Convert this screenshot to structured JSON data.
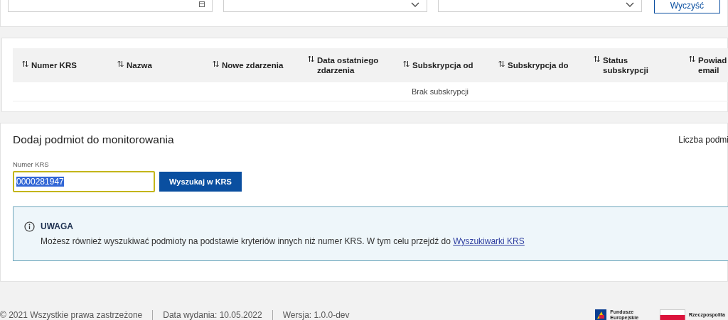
{
  "filters": {
    "fields": [
      {
        "kind": "date"
      },
      {
        "kind": "select"
      },
      {
        "kind": "select"
      }
    ],
    "clear_button": "Wyczyść"
  },
  "table": {
    "columns": [
      {
        "label": "Numer KRS"
      },
      {
        "label": "Nazwa"
      },
      {
        "label": "Nowe zdarzenia"
      },
      {
        "label": "Data ostatniego zdarzenia"
      },
      {
        "label": "Subskrypcja od"
      },
      {
        "label": "Subskrypcja do"
      },
      {
        "label": "Status subskrypcji"
      },
      {
        "label": "Powiad email"
      }
    ],
    "empty_text": "Brak subskrypcji"
  },
  "add_panel": {
    "title": "Dodaj podmiot do monitorowania",
    "count_label": "Liczba podmi",
    "field_label": "Numer KRS",
    "field_value": "0000281947",
    "value_selected": true,
    "search_button": "Wyszukaj w KRS",
    "notice": {
      "title": "UWAGA",
      "text": "Możesz również wyszukiwać podmioty na podstawie kryteriów innych niż numer KRS. W tym celu przejdź do",
      "link": "Wyszukiwarki KRS"
    }
  },
  "footer": {
    "items": [
      "© 2021 Wszystkie prawa zastrzeżone",
      "Data wydania: 10.05.2022",
      "Wersja: 1.0.0-dev"
    ],
    "logos": [
      {
        "kind": "eu-funds",
        "lines": [
          "Fundusze",
          "Europejskie"
        ]
      },
      {
        "kind": "flag",
        "lines": [
          "Rzeczpospolita"
        ]
      }
    ]
  }
}
